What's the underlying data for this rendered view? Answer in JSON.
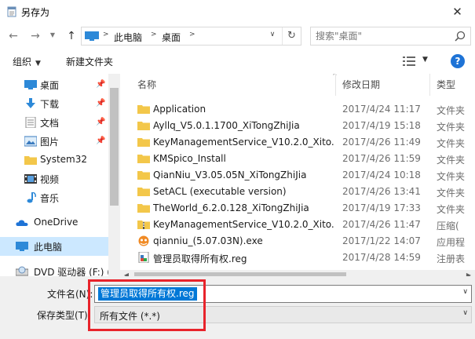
{
  "window": {
    "title": "另存为",
    "close_glyph": "✕"
  },
  "address": {
    "crumbs": [
      "此电脑",
      "桌面"
    ],
    "search_placeholder": "搜索\"桌面\""
  },
  "toolbar": {
    "organize": "组织",
    "new_folder": "新建文件夹"
  },
  "sidebar": {
    "items": [
      {
        "label": "桌面",
        "icon": "desktop-icon",
        "pinned": true
      },
      {
        "label": "下载",
        "icon": "download-arrow-icon",
        "pinned": true
      },
      {
        "label": "文档",
        "icon": "document-icon",
        "pinned": true
      },
      {
        "label": "图片",
        "icon": "picture-icon",
        "pinned": true
      },
      {
        "label": "System32",
        "icon": "folder-icon",
        "pinned": false
      },
      {
        "label": "视频",
        "icon": "video-icon",
        "pinned": false
      },
      {
        "label": "音乐",
        "icon": "music-icon",
        "pinned": false
      },
      {
        "label": "OneDrive",
        "icon": "cloud-icon",
        "pinned": false
      },
      {
        "label": "此电脑",
        "icon": "this-pc-icon",
        "pinned": false,
        "selected": true
      },
      {
        "label": "DVD 驱动器 (F:) (",
        "icon": "dvd-drive-icon",
        "pinned": false
      }
    ]
  },
  "filelist": {
    "columns": [
      "名称",
      "修改日期",
      "类型"
    ],
    "rows": [
      {
        "name": "Application",
        "date": "2017/4/24 11:17",
        "type": "文件夹",
        "icon": "folder"
      },
      {
        "name": "Ayllq_V5.0.1.1700_XiTongZhiJia",
        "date": "2017/4/19 15:18",
        "type": "文件夹",
        "icon": "folder"
      },
      {
        "name": "KeyManagementService_V10.2.0_Xito...",
        "date": "2017/4/26 11:49",
        "type": "文件夹",
        "icon": "folder"
      },
      {
        "name": "KMSpico_Install",
        "date": "2017/4/26 11:59",
        "type": "文件夹",
        "icon": "folder"
      },
      {
        "name": "QianNiu_V3.05.05N_XiTongZhiJia",
        "date": "2017/4/24 10:18",
        "type": "文件夹",
        "icon": "folder"
      },
      {
        "name": "SetACL (executable version)",
        "date": "2017/4/26 13:41",
        "type": "文件夹",
        "icon": "folder"
      },
      {
        "name": "TheWorld_6.2.0.128_XiTongZhiJia",
        "date": "2017/4/19 17:33",
        "type": "文件夹",
        "icon": "folder"
      },
      {
        "name": "KeyManagementService_V10.2.0_Xito...",
        "date": "2017/4/26 11:47",
        "type": "压缩(",
        "icon": "zip"
      },
      {
        "name": "qianniu_(5.07.03N).exe",
        "date": "2017/1/22 14:07",
        "type": "应用程",
        "icon": "exe"
      },
      {
        "name": "管理员取得所有权.reg",
        "date": "2017/4/28 14:59",
        "type": "注册表",
        "icon": "reg"
      }
    ]
  },
  "bottom": {
    "filename_label": "文件名(N):",
    "filename_value": "管理员取得所有权.reg",
    "filetype_label": "保存类型(T):",
    "filetype_value": "所有文件  (*.*)"
  },
  "colors": {
    "selected_bg": "#cce8ff",
    "highlight": "#0078d7",
    "annotation_red": "#e8232b",
    "folder": "#f3c74a"
  }
}
